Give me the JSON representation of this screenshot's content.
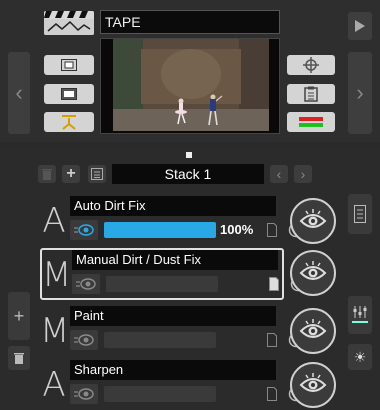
{
  "viewer": {
    "title": "TAPE"
  },
  "stack": {
    "title": "Stack 1"
  },
  "effects": [
    {
      "letter": "A",
      "name": "Auto Dirt Fix",
      "progress_label": "100%",
      "progress_value": 1.0
    },
    {
      "letter": "M",
      "name": "Manual Dirt / Dust Fix"
    },
    {
      "letter": "M",
      "name": "Paint"
    },
    {
      "letter": "A",
      "name": "Sharpen"
    }
  ],
  "colors": {
    "accent": "#28a9e6",
    "panel": "#2b2b2b",
    "field": "#0a0a0a",
    "indicator_red": "#e02020",
    "indicator_green": "#20c020"
  },
  "icons": {
    "clapper": "clapperboard-icon",
    "target": "crosshair-icon",
    "clipboard": "clipboard-icon",
    "eye": "eye-icon",
    "trash": "trash-icon",
    "plus": "plus-icon",
    "sliders": "sliders-icon",
    "sun": "brightness-icon",
    "doc": "document-icon",
    "ban": "disable-icon"
  }
}
